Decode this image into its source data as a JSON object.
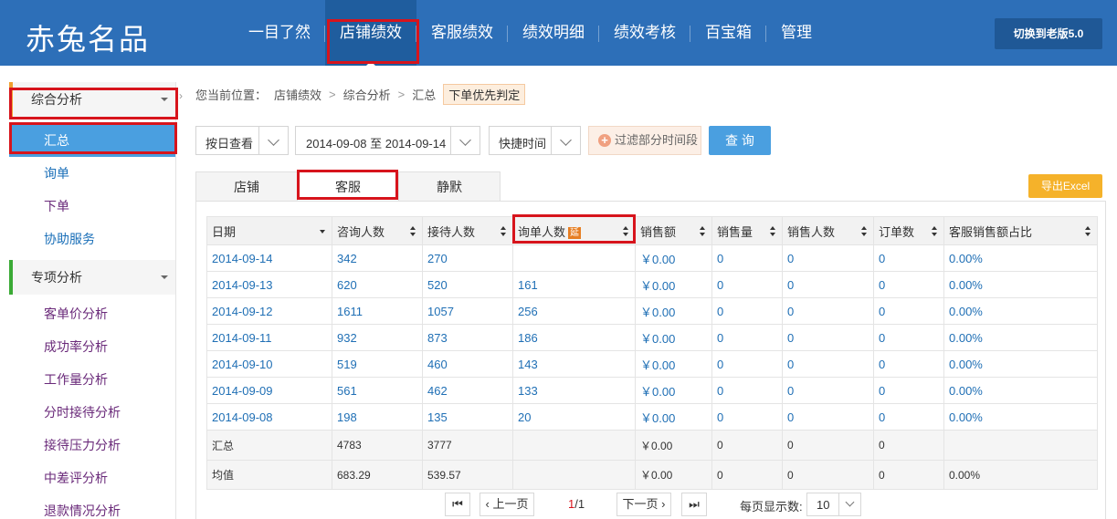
{
  "header": {
    "logo": "赤兔名品",
    "nav": [
      "一目了然",
      "店铺绩效",
      "客服绩效",
      "绩效明细",
      "绩效考核",
      "百宝箱",
      "管理"
    ],
    "active_nav": "店铺绩效",
    "switch_label": "切换到老版5.0",
    "bg_color": "#2d6fb8"
  },
  "sidebar": {
    "group1": "综合分析",
    "group1_items": [
      "汇总",
      "询单",
      "下单",
      "协助服务"
    ],
    "group2": "专项分析",
    "group2_items": [
      "客单价分析",
      "成功率分析",
      "工作量分析",
      "分时接待分析",
      "接待压力分析",
      "中差评分析",
      "退款情况分析"
    ]
  },
  "breadcrumb": {
    "prefix": "您当前位置：",
    "path": [
      "店铺绩效",
      "综合分析",
      "汇总"
    ],
    "sep": ">",
    "tag": "下单优先判定"
  },
  "filters": {
    "view_mode": "按日查看",
    "date_range": "2014-09-08 至 2014-09-14",
    "quick_time": "快捷时间",
    "exclude_label": "过滤部分时间段",
    "query_label": "查 询"
  },
  "tabs": [
    "店铺",
    "客服",
    "静默"
  ],
  "active_tab": "客服",
  "export_label": "导出Excel",
  "table": {
    "headers": [
      "日期",
      "咨询人数",
      "接待人数",
      "询单人数",
      "销售额",
      "销售量",
      "销售人数",
      "订单数",
      "客服销售额占比"
    ],
    "delay_badge": "延",
    "rows": [
      [
        "2014-09-14",
        "342",
        "270",
        "",
        "￥0.00",
        "0",
        "0",
        "0",
        "0.00%"
      ],
      [
        "2014-09-13",
        "620",
        "520",
        "161",
        "￥0.00",
        "0",
        "0",
        "0",
        "0.00%"
      ],
      [
        "2014-09-12",
        "1611",
        "1057",
        "256",
        "￥0.00",
        "0",
        "0",
        "0",
        "0.00%"
      ],
      [
        "2014-09-11",
        "932",
        "873",
        "186",
        "￥0.00",
        "0",
        "0",
        "0",
        "0.00%"
      ],
      [
        "2014-09-10",
        "519",
        "460",
        "143",
        "￥0.00",
        "0",
        "0",
        "0",
        "0.00%"
      ],
      [
        "2014-09-09",
        "561",
        "462",
        "133",
        "￥0.00",
        "0",
        "0",
        "0",
        "0.00%"
      ],
      [
        "2014-09-08",
        "198",
        "135",
        "20",
        "￥0.00",
        "0",
        "0",
        "0",
        "0.00%"
      ]
    ],
    "total": [
      "汇总",
      "4783",
      "3777",
      "",
      "￥0.00",
      "0",
      "0",
      "0",
      ""
    ],
    "average": [
      "均值",
      "683.29",
      "539.57",
      "",
      "￥0.00",
      "0",
      "0",
      "0",
      "0.00%"
    ]
  },
  "pagination": {
    "first": "⏮",
    "prev": "上一页",
    "current": "1",
    "total": "1",
    "next": "下一页",
    "last": "⏭",
    "per_page_label": "每页显示数:",
    "per_page": "10"
  }
}
